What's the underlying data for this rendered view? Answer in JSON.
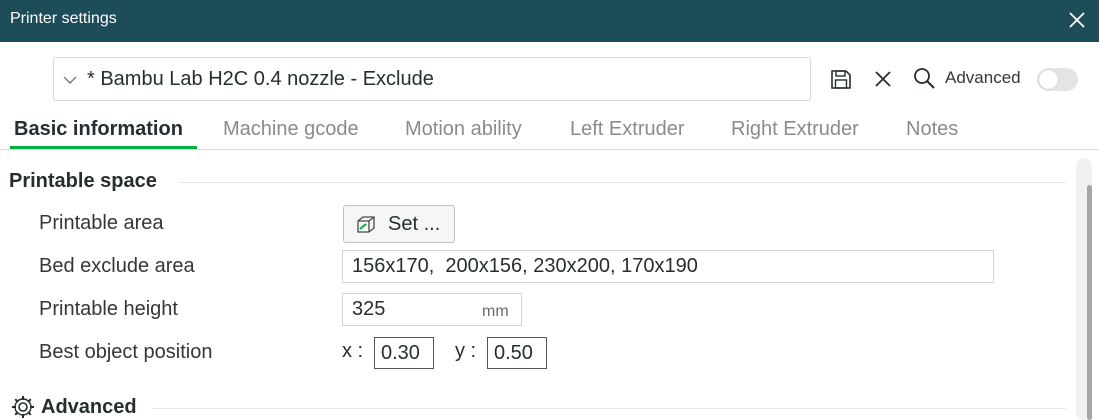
{
  "window": {
    "title": "Printer settings"
  },
  "preset": {
    "name": "* Bambu Lab H2C 0.4 nozzle - Exclude"
  },
  "toolbar": {
    "advanced_label": "Advanced",
    "advanced_on": false
  },
  "tabs": [
    {
      "label": "Basic information",
      "active": true
    },
    {
      "label": "Machine gcode"
    },
    {
      "label": "Motion ability"
    },
    {
      "label": "Left Extruder"
    },
    {
      "label": "Right Extruder"
    },
    {
      "label": "Notes"
    }
  ],
  "printable_space": {
    "title": "Printable space",
    "printable_area": {
      "label": "Printable area",
      "button_label": "Set ..."
    },
    "bed_exclude": {
      "label": "Bed exclude area",
      "value": "156x170,  200x156, 230x200, 170x190"
    },
    "printable_height": {
      "label": "Printable height",
      "value": "325",
      "unit": "mm"
    },
    "best_object_position": {
      "label": "Best object position",
      "x_label": "x :",
      "x_value": "0.30",
      "y_label": "y :",
      "y_value": "0.50"
    }
  },
  "advanced_section": {
    "title": "Advanced"
  },
  "colors": {
    "titlebar": "#1e4d5a",
    "accent": "#00ae42",
    "text": "#262e30"
  },
  "icons": [
    "close-icon",
    "chevron-down-icon",
    "save-icon",
    "discard-icon",
    "search-icon",
    "printable-area-icon",
    "gear-icon"
  ]
}
